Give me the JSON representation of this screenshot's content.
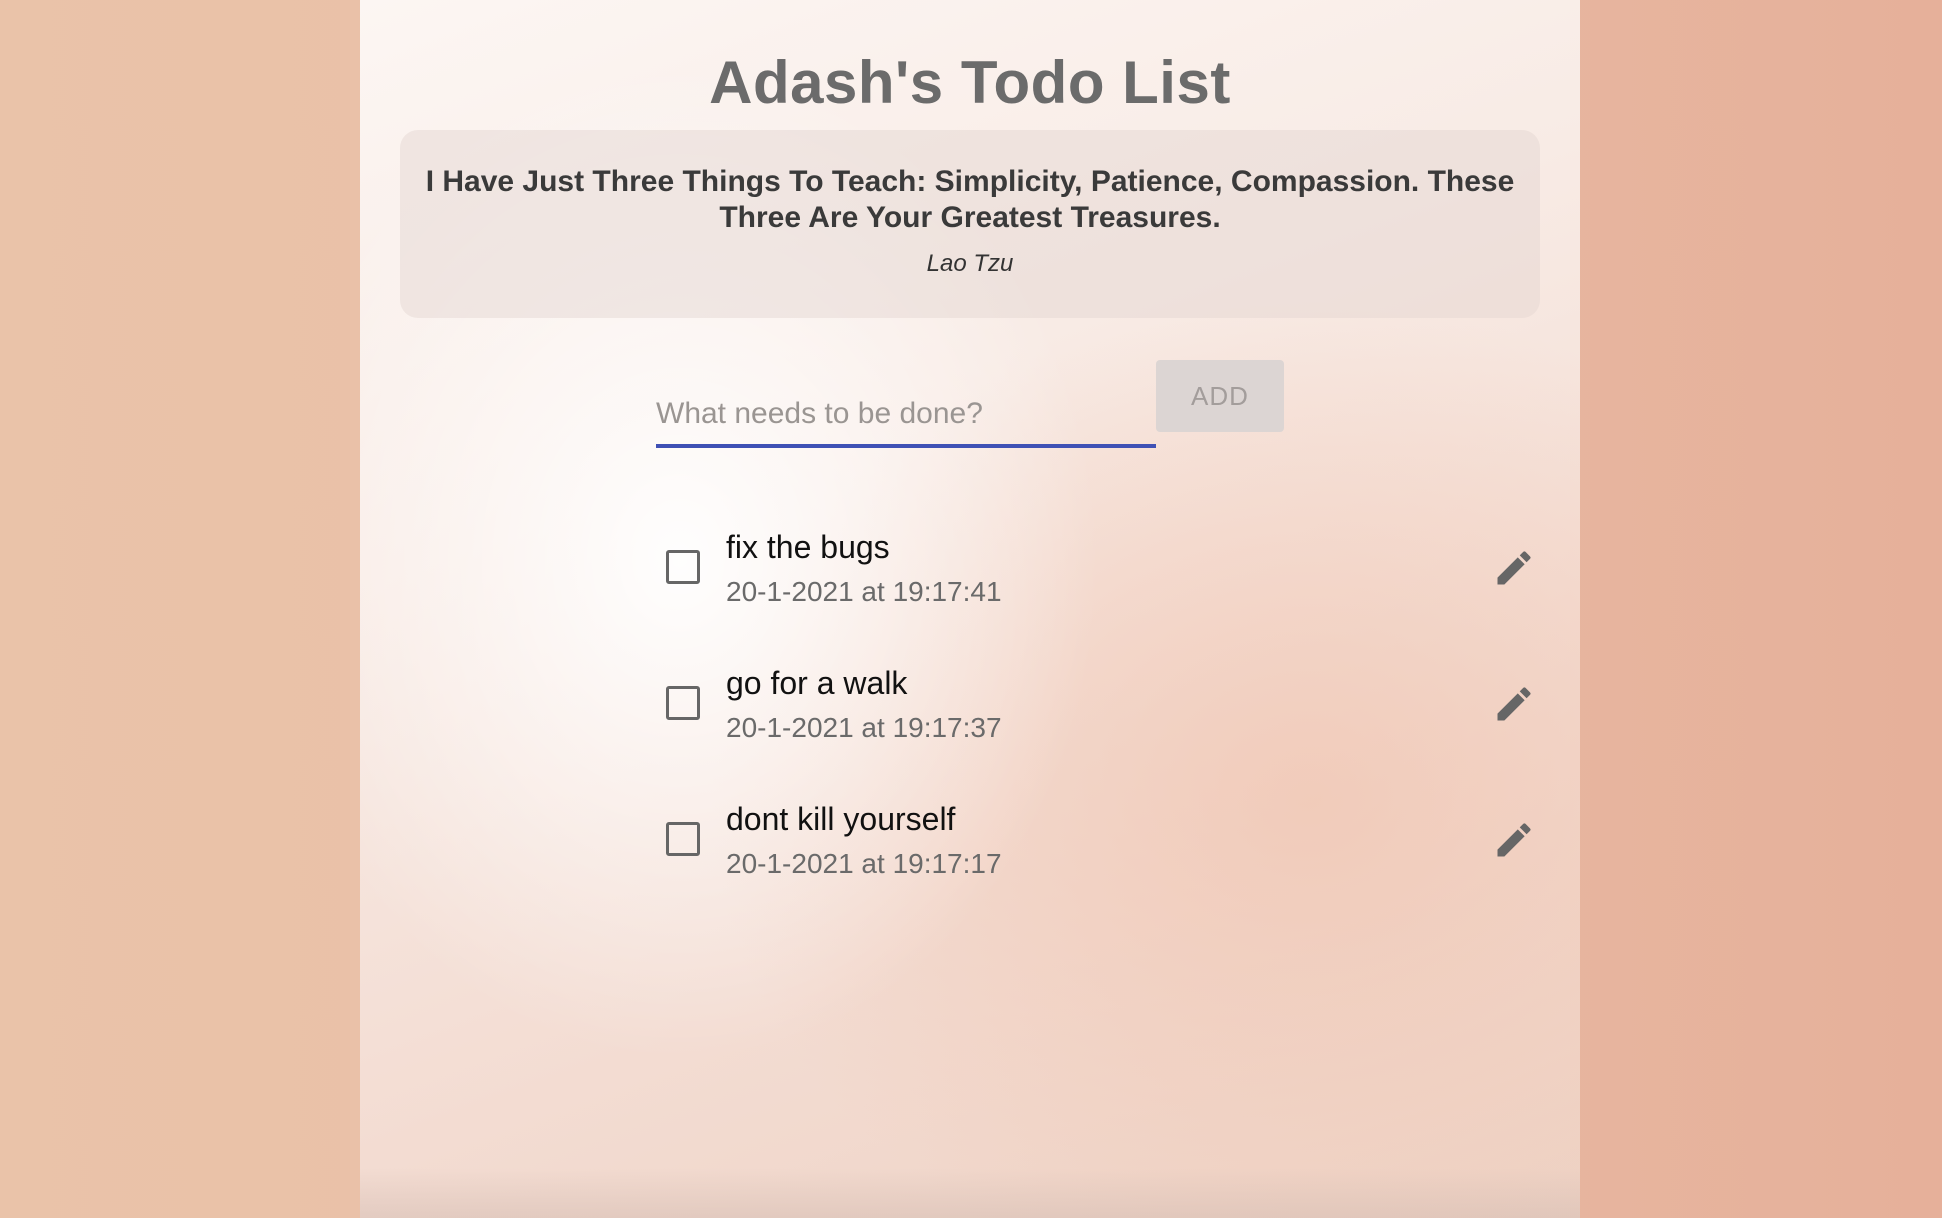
{
  "header": {
    "title": "Adash's Todo List"
  },
  "quote": {
    "text": "I Have Just Three Things To Teach: Simplicity, Patience, Compassion. These Three Are Your Greatest Treasures.",
    "author": "Lao Tzu"
  },
  "input": {
    "placeholder": "What needs to be done?",
    "value": ""
  },
  "add_button": {
    "label": "ADD"
  },
  "todos": [
    {
      "text": "fix the bugs",
      "timestamp": "20-1-2021 at 19:17:41",
      "completed": false
    },
    {
      "text": "go for a walk",
      "timestamp": "20-1-2021 at 19:17:37",
      "completed": false
    },
    {
      "text": "dont kill yourself",
      "timestamp": "20-1-2021 at 19:17:17",
      "completed": false
    }
  ],
  "icons": {
    "edit": "pencil-icon",
    "delete": "trash-icon"
  },
  "colors": {
    "accent": "#3f51b5",
    "icon": "#666666",
    "title": "#6b6b6b"
  }
}
